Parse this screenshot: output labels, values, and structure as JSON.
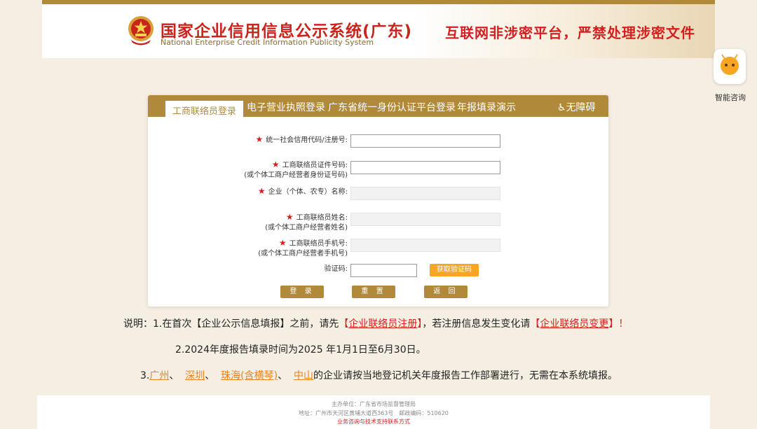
{
  "header": {
    "title": "国家企业信用信息公示系统(广东)",
    "subtitle": "National Enterprise Credit Information Publicity System",
    "slogan": "互联网非涉密平台，严禁处理涉密文件"
  },
  "assistant": {
    "label": "智能咨询",
    "icon": "chat-bot-icon"
  },
  "tabs": [
    {
      "label": "工商联络员登录",
      "active": true
    },
    {
      "label": "电子营业执照登录",
      "active": false
    },
    {
      "label": "广东省统一身份认证平台登录",
      "active": false
    },
    {
      "label": "年报填录演示",
      "active": false
    }
  ],
  "accessibility": {
    "label": "无障碍",
    "icon": "wheelchair-icon"
  },
  "form": {
    "credit_code": {
      "label": "统一社会信用代码/注册号:",
      "value": ""
    },
    "id_number": {
      "label": "工商联络员证件号码:",
      "sublabel": "(或个体工商户经营者身份证号码)",
      "value": ""
    },
    "company_name": {
      "label": "企业（个体、农专）名称:",
      "value": ""
    },
    "contact_name": {
      "label": "工商联络员姓名:",
      "sublabel": "(或个体工商户经营者姓名)",
      "value": ""
    },
    "contact_phone": {
      "label": "工商联络员手机号:",
      "sublabel": "(或个体工商户经营者手机号)",
      "value": ""
    },
    "captcha": {
      "label": "验证码:",
      "value": "",
      "button": "获取验证码"
    },
    "buttons": {
      "login": "登 录",
      "reset": "重 置",
      "back": "返 回"
    }
  },
  "notes": {
    "line1_prefix": "说明：1.在首次【企业公示信息填报】之前，请先",
    "line1_bracket_open": "【",
    "line1_link1": "企业联络员注册",
    "line1_bracket_close": "】",
    "line1_middle": "，若注册信息发生变化请",
    "line1_link2": "企业联络员变更",
    "line1_end": "】！",
    "line2": "2.2024年度报告填录时间为2025 年1月1日至6月30日。",
    "line3_prefix": "3.",
    "cities": [
      "广州",
      "深圳",
      "珠海(含横琴)",
      "中山"
    ],
    "sep": "、",
    "line3_suffix": "的企业请按当地登记机关年度报告工作部署进行，无需在本系统填报。"
  },
  "footer": {
    "sponsor": "主办单位：广东省市场监督管理局",
    "address": "地址：广州市天河区黄埔大道西363号　邮政编码：510620",
    "support": "业务咨询与技术支持联系方式"
  },
  "colors": {
    "brand": "#b08a3a",
    "accent_red": "#d51f1f",
    "orange": "#f6a623"
  }
}
